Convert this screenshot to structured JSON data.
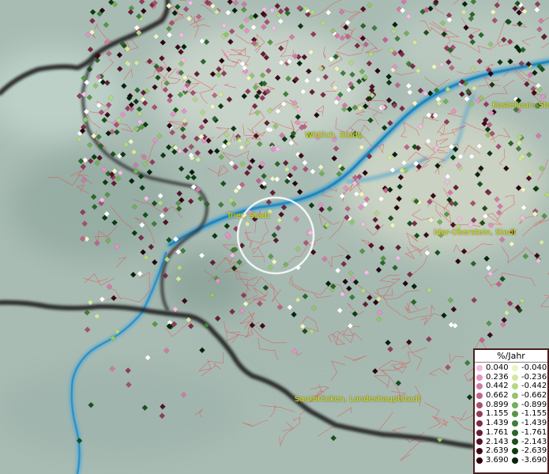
{
  "map": {
    "places": [
      {
        "name": "Wittlich, Stadt"
      },
      {
        "name": "Kastellaun, Stadt"
      },
      {
        "name": "Trier, Stadt"
      },
      {
        "name": "Idar-Oberstein, Stadt"
      },
      {
        "name": "Saarbrücken, Landeshauptstadt"
      }
    ],
    "legend": {
      "title": "%/Jahr",
      "positive": [
        {
          "label": "0.040",
          "color": "#f2bce3"
        },
        {
          "label": "0.236",
          "color": "#e493c6"
        },
        {
          "label": "0.442",
          "color": "#d37aa8"
        },
        {
          "label": "0.662",
          "color": "#c06489"
        },
        {
          "label": "0.899",
          "color": "#a94f70"
        },
        {
          "label": "1.155",
          "color": "#923c5a"
        },
        {
          "label": "1.439",
          "color": "#7c2c47"
        },
        {
          "label": "1.761",
          "color": "#661d36"
        },
        {
          "label": "2.143",
          "color": "#521227"
        },
        {
          "label": "2.639",
          "color": "#3e0a1a"
        },
        {
          "label": "3.690",
          "color": "#29040e"
        }
      ],
      "negative": [
        {
          "label": "-0.040",
          "color": "#eef5c0"
        },
        {
          "label": "-0.236",
          "color": "#d3e89f"
        },
        {
          "label": "-0.442",
          "color": "#b5d784"
        },
        {
          "label": "-0.662",
          "color": "#95c46c"
        },
        {
          "label": "-0.899",
          "color": "#75ae58"
        },
        {
          "label": "-1.155",
          "color": "#589646"
        },
        {
          "label": "-1.439",
          "color": "#3f7e36"
        },
        {
          "label": "-1.761",
          "color": "#2a6628"
        },
        {
          "label": "-2.143",
          "color": "#19501b"
        },
        {
          "label": "-2.639",
          "color": "#0c3a10"
        },
        {
          "label": "-3.690",
          "color": "#032408"
        }
      ]
    }
  }
}
